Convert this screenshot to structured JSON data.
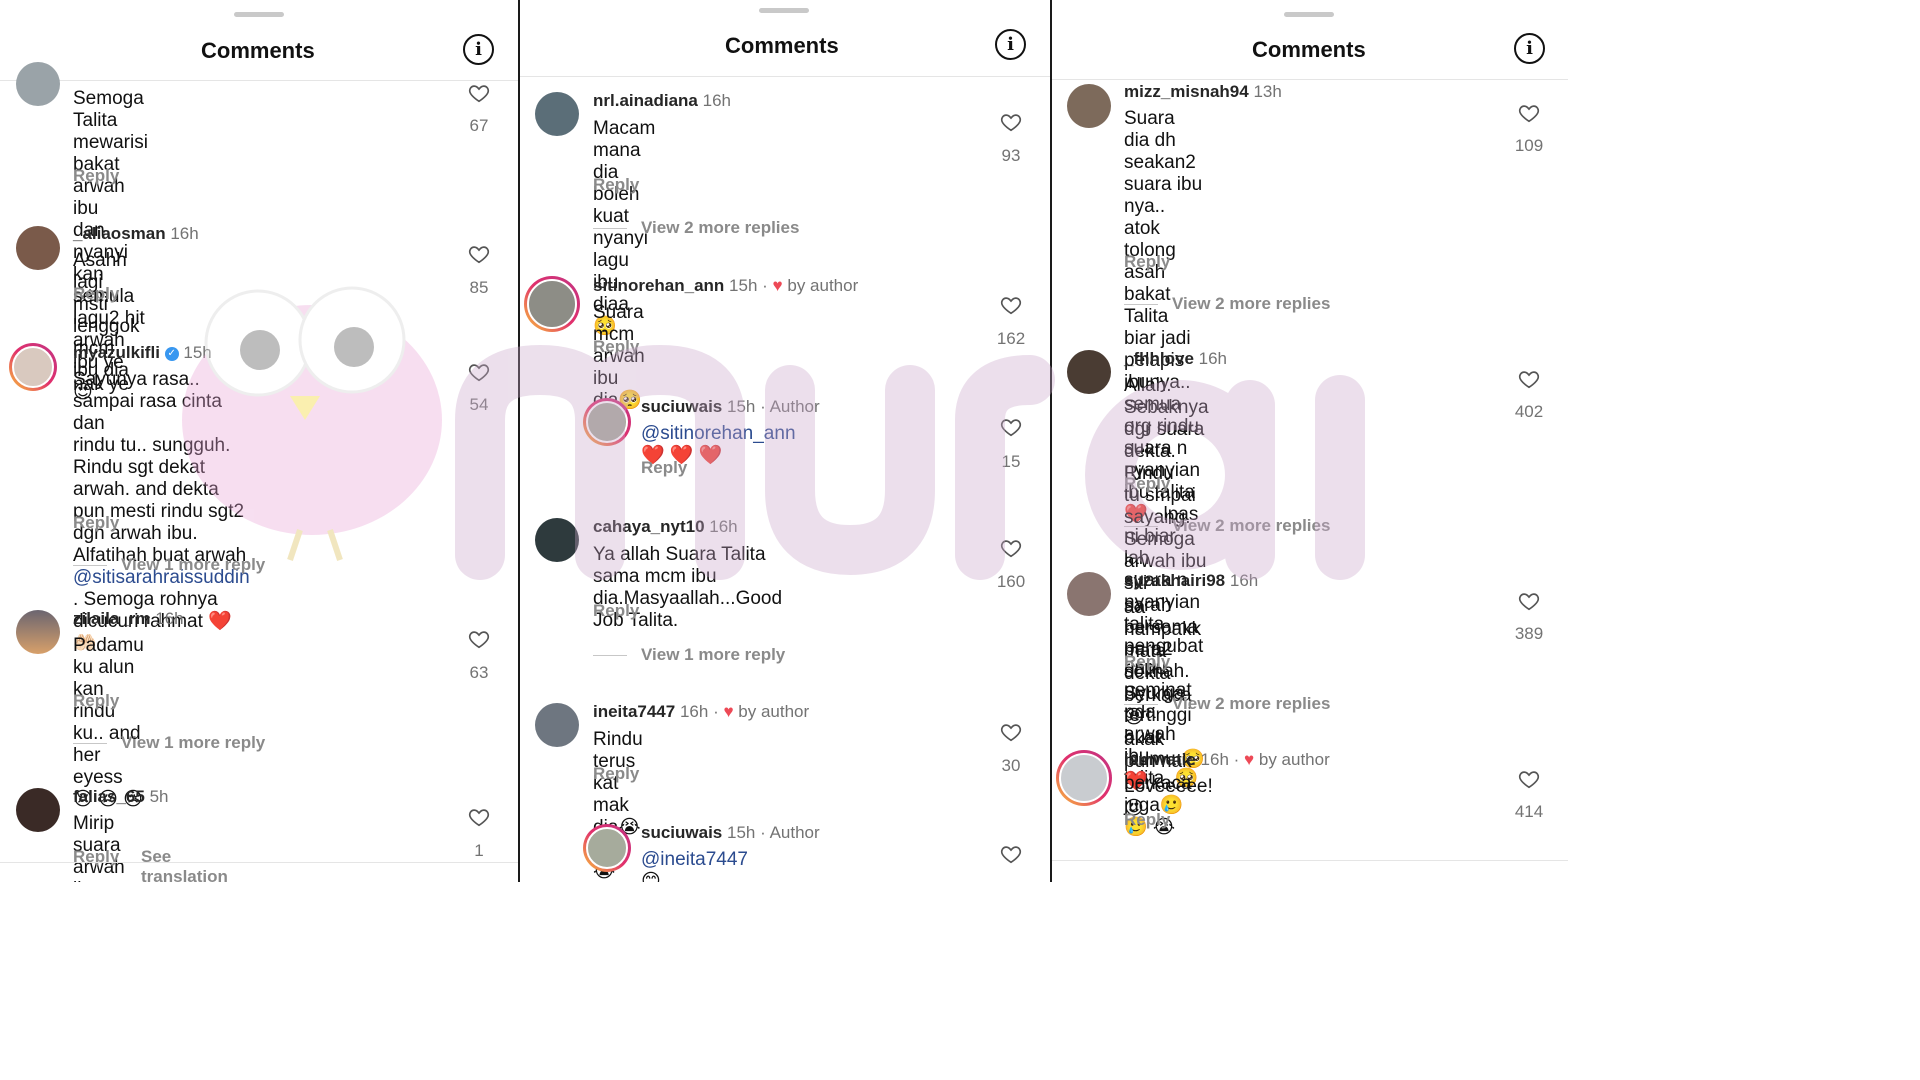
{
  "header": {
    "title": "Comments"
  },
  "panels": [
    {
      "comments": [
        {
          "user": "",
          "time": "",
          "text": "Semoga Talita mewarisi bakat arwah ibu\ndan nyanyi kan semula lagu2 hit arwah\nibu ye nak ye",
          "likes": "67",
          "reply": "Reply"
        },
        {
          "user": "_aliaosman",
          "time": "16h",
          "text": "Asahh lagi msti lenggok mcm ibu dia😍",
          "likes": "85",
          "reply": "Reply"
        },
        {
          "user": "myazulkifli",
          "time": "15h",
          "text_a": "Sayunya rasa.. sampai rasa cinta dan\nrindu tu.. sungguh. Rindu sgt dekat\narwah. and dekta pun mesti rindu sgt2\ndgn arwah ibu. Alfatihah buat arwah",
          "mention": "@sitisarahraissuddin",
          "text_b": " . Semoga rohnya",
          "text_c": "dicucuri rahmat ❤️ 🤲🏻",
          "likes": "54",
          "reply": "Reply",
          "view": "View 1 more reply"
        },
        {
          "user": "zilaila_rm",
          "time": "16h",
          "text": "Padamu ku alun kan rindu ku.. and her\neyess 😢 😢 😢",
          "likes": "63",
          "reply": "Reply",
          "view": "View 1 more reply"
        },
        {
          "user": "falias_65",
          "time": "5h",
          "text": "Mirip suara arwah ibunya.. merdu",
          "likes": "1",
          "reply": "Reply",
          "see_translation": "See translation"
        }
      ]
    },
    {
      "comments": [
        {
          "user": "nrl.ainadiana",
          "time": "16h",
          "text": "Macam mana dia boleh kuat nyanyi lagu\nibu diaa 🥺",
          "likes": "93",
          "reply": "Reply",
          "view": "View 2 more replies"
        },
        {
          "user": "sitinorehan_ann",
          "time": "15h",
          "by_author": "by author",
          "text": "Suara mcm arwah ibu dia🥺",
          "likes": "162",
          "reply": "Reply"
        },
        {
          "user": "suciuwais",
          "time": "15h",
          "author": "Author",
          "mention": "@sitinorehan_ann",
          "text": " ❤️ ❤️ ❤️",
          "likes": "15",
          "reply": "Reply"
        },
        {
          "user": "cahaya_nyt10",
          "time": "16h",
          "text": "Ya allah Suara Talita sama mcm ibu\ndia.Masyaallah...Good Job Talita.",
          "likes": "160",
          "reply": "Reply",
          "view": "View 1 more reply"
        },
        {
          "user": "ineita7447",
          "time": "16h",
          "by_author": "by author",
          "text": "Rindu terus kat mak dia😭 😭 😭",
          "likes": "30",
          "reply": "Reply"
        },
        {
          "user": "suciuwais",
          "time": "15h",
          "author": "Author",
          "mention": "@ineita7447",
          "text": " 😊"
        }
      ]
    },
    {
      "comments": [
        {
          "user": "mizz_misnah94",
          "time": "13h",
          "text": "Suara dia dh seakan2 suara ibu nya..\natok tolong asah bakat Talita biar jadi\npelapis ibunya.. semua org rindu suara n\nnyanyian ibu talita❤️.. lpas ni biar lah\nsuara n nyanyian talita pengubat rindu\npeminat pda arwah ibu talita..🥺",
          "likes": "109",
          "reply": "Reply",
          "view": "View 2 more replies"
        },
        {
          "user": "_fhhlove",
          "time": "16h",
          "text": "Allah. Sebaknya dgr suara dekta. Rindu\ntu smpai sayang. Semoga arwah ibu siti\nsarah bersama para2 solihah. Syurga\ntertinggi buat ibumu 🥺 ❤️",
          "likes": "402",
          "reply": "Reply",
          "view": "View 2 more replies"
        },
        {
          "user": "syzakhairi98",
          "time": "16h",
          "text": "aa nampakk mata dekta berkaca 😢\nakak pun nak berkaca juga🥲 🥲 😭",
          "likes": "389",
          "reply": "Reply",
          "view": "View 2 more replies"
        },
        {
          "user": "iamwatie",
          "time": "16h",
          "by_author": "by author",
          "text": "Loveeeee!😍",
          "likes": "414",
          "reply": "Reply"
        }
      ]
    }
  ],
  "icons": {
    "info": "info-circle-icon",
    "heart": "heart-outline-icon",
    "verified": "verified-badge-icon"
  },
  "colors": {
    "ring_start": "#f9c33a",
    "ring_end": "#c13584",
    "mention": "#2b4b8f",
    "heart_red": "#ed4956",
    "verified": "#3897f0"
  }
}
